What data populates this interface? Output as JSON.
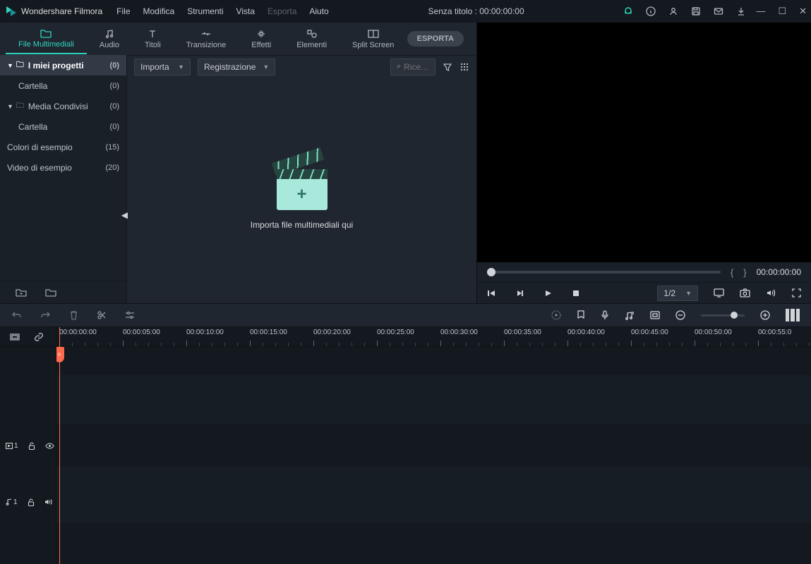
{
  "app": {
    "title": "Wondershare Filmora"
  },
  "menu": [
    "File",
    "Modifica",
    "Strumenti",
    "Vista",
    "Esporta",
    "Aiuto"
  ],
  "menu_disabled_index": 4,
  "titlebar": {
    "project_status": "Senza titolo : 00:00:00:00"
  },
  "tabs": [
    {
      "icon": "folder",
      "label": "File Multimediali"
    },
    {
      "icon": "music",
      "label": "Audio"
    },
    {
      "icon": "text",
      "label": "Titoli"
    },
    {
      "icon": "transition",
      "label": "Transizione"
    },
    {
      "icon": "effects",
      "label": "Effetti"
    },
    {
      "icon": "elements",
      "label": "Elementi"
    },
    {
      "icon": "split",
      "label": "Split Screen"
    }
  ],
  "tabs_active_index": 0,
  "export_chip": "ESPORTA",
  "sidebar": {
    "items": [
      {
        "kind": "folder",
        "label": "I miei progetti",
        "count": "(0)",
        "selected": true,
        "expand": true
      },
      {
        "kind": "sub",
        "label": "Cartella",
        "count": "(0)"
      },
      {
        "kind": "folder",
        "label": "Media Condivisi",
        "count": "(0)",
        "expand": true
      },
      {
        "kind": "sub",
        "label": "Cartella",
        "count": "(0)"
      },
      {
        "kind": "plain",
        "label": "Colori di esempio",
        "count": "(15)"
      },
      {
        "kind": "plain",
        "label": "Video di esempio",
        "count": "(20)"
      }
    ]
  },
  "mediabar": {
    "import_label": "Importa",
    "record_label": "Registrazione",
    "search_placeholder": "Rice..."
  },
  "media_drop_text": "Importa file multimediali qui",
  "preview": {
    "timecode": "00:00:00:00",
    "ratio": "1/2"
  },
  "ruler_ticks": [
    "00:00:00:00",
    "00:00:05:00",
    "00:00:10:00",
    "00:00:15:00",
    "00:00:20:00",
    "00:00:25:00",
    "00:00:30:00",
    "00:00:35:00",
    "00:00:40:00",
    "00:00:45:00",
    "00:00:50:00",
    "00:00:55:0"
  ],
  "tracks": {
    "video_label": "1",
    "audio_label": "1"
  }
}
